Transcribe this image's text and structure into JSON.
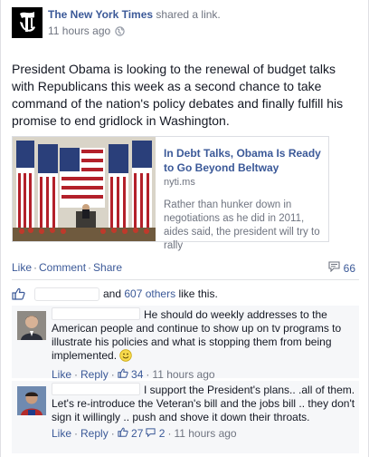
{
  "post": {
    "poster": "The New York Times",
    "shared_text": "shared a link.",
    "time": "11 hours ago",
    "message": "President Obama is looking to the renewal of budget talks with Republicans this week as a second chance to take command of the nation's policy debates and finally fulfill his promise to end gridlock in Washington."
  },
  "link": {
    "title": "In Debt Talks, Obama Is Ready to Go Beyond Beltway",
    "domain": "nyti.ms",
    "description": "Rather than hunker down in negotiations as he did in 2011, aides said, the president will try to rally"
  },
  "actions": {
    "like": "Like",
    "comment": "Comment",
    "share": "Share",
    "comment_count": "66"
  },
  "likes": {
    "and": "and",
    "others": "607 others",
    "suffix": "like this."
  },
  "comments": [
    {
      "text": "He should do weekly addresses to the American people and continue to show up on tv programs to illustrate his policies and what is stopping them from being implemented.",
      "like": "Like",
      "reply": "Reply",
      "likes": "34",
      "time": "11 hours ago"
    },
    {
      "text": "I support the President's plans.. .all of them. Let's re-introduce the Veteran's bill and the jobs bill .. they don't sign it willingly .. push and shove it down their throats.",
      "like": "Like",
      "reply": "Reply",
      "likes": "27",
      "replies": "2",
      "time": "11 hours ago"
    }
  ],
  "colors": {
    "link_blue": "#3b5998",
    "meta_gray": "#6f7480",
    "comment_bg": "#f6f7f9"
  }
}
